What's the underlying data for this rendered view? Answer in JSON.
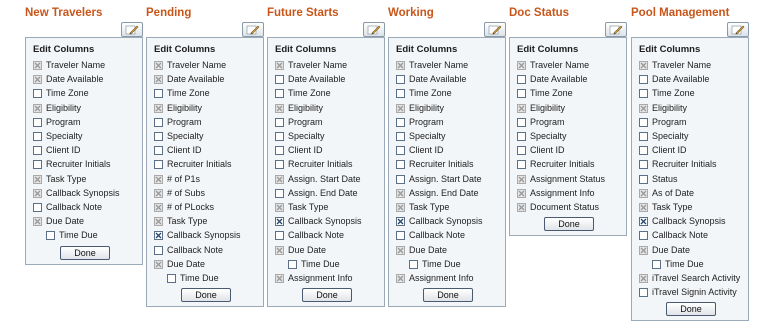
{
  "edit_columns_title": "Edit Columns",
  "done_label": "Done",
  "colors": {
    "title": "#c8561a",
    "checkbox_border": "#5b6f86",
    "checkbox_disabled": "#aaaaaa",
    "panel_bg": "#f3f6f8"
  },
  "panels": [
    {
      "title": "New Travelers",
      "items": [
        {
          "label": "Traveler Name",
          "state": "grey"
        },
        {
          "label": "Date Available",
          "state": "grey"
        },
        {
          "label": "Time Zone",
          "state": "empty"
        },
        {
          "label": "Eligibility",
          "state": "grey"
        },
        {
          "label": "Program",
          "state": "empty"
        },
        {
          "label": "Specialty",
          "state": "empty"
        },
        {
          "label": "Client ID",
          "state": "empty"
        },
        {
          "label": "Recruiter Initials",
          "state": "empty"
        },
        {
          "label": "Task Type",
          "state": "grey"
        },
        {
          "label": "Callback Synopsis",
          "state": "grey"
        },
        {
          "label": "Callback Note",
          "state": "empty"
        },
        {
          "label": "Due Date",
          "state": "grey"
        },
        {
          "label": "Time Due",
          "state": "empty",
          "indent": true
        }
      ]
    },
    {
      "title": "Pending",
      "items": [
        {
          "label": "Traveler Name",
          "state": "grey"
        },
        {
          "label": "Date Available",
          "state": "grey"
        },
        {
          "label": "Time Zone",
          "state": "empty"
        },
        {
          "label": "Eligibility",
          "state": "grey"
        },
        {
          "label": "Program",
          "state": "empty"
        },
        {
          "label": "Specialty",
          "state": "empty"
        },
        {
          "label": "Client ID",
          "state": "empty"
        },
        {
          "label": "Recruiter Initials",
          "state": "empty"
        },
        {
          "label": "# of P1s",
          "state": "grey"
        },
        {
          "label": "# of Subs",
          "state": "grey"
        },
        {
          "label": "# of PLocks",
          "state": "grey"
        },
        {
          "label": "Task Type",
          "state": "grey"
        },
        {
          "label": "Callback Synopsis",
          "state": "checked"
        },
        {
          "label": "Callback Note",
          "state": "empty"
        },
        {
          "label": "Due Date",
          "state": "grey"
        },
        {
          "label": "Time Due",
          "state": "empty",
          "indent": true
        }
      ]
    },
    {
      "title": "Future Starts",
      "items": [
        {
          "label": "Traveler Name",
          "state": "grey"
        },
        {
          "label": "Date Available",
          "state": "empty"
        },
        {
          "label": "Time Zone",
          "state": "empty"
        },
        {
          "label": "Eligibility",
          "state": "grey"
        },
        {
          "label": "Program",
          "state": "empty"
        },
        {
          "label": "Specialty",
          "state": "empty"
        },
        {
          "label": "Client ID",
          "state": "empty"
        },
        {
          "label": "Recruiter Initials",
          "state": "empty"
        },
        {
          "label": "Assign. Start Date",
          "state": "grey"
        },
        {
          "label": "Assign. End Date",
          "state": "empty"
        },
        {
          "label": "Task Type",
          "state": "grey"
        },
        {
          "label": "Callback Synopsis",
          "state": "checked"
        },
        {
          "label": "Callback Note",
          "state": "empty"
        },
        {
          "label": "Due Date",
          "state": "grey"
        },
        {
          "label": "Time Due",
          "state": "empty",
          "indent": true
        },
        {
          "label": "Assignment Info",
          "state": "grey"
        }
      ]
    },
    {
      "title": "Working",
      "items": [
        {
          "label": "Traveler Name",
          "state": "grey"
        },
        {
          "label": "Date Available",
          "state": "empty"
        },
        {
          "label": "Time Zone",
          "state": "empty"
        },
        {
          "label": "Eligibility",
          "state": "grey"
        },
        {
          "label": "Program",
          "state": "empty"
        },
        {
          "label": "Specialty",
          "state": "empty"
        },
        {
          "label": "Client ID",
          "state": "empty"
        },
        {
          "label": "Recruiter Initials",
          "state": "empty"
        },
        {
          "label": "Assign. Start Date",
          "state": "empty"
        },
        {
          "label": "Assign. End Date",
          "state": "grey"
        },
        {
          "label": "Task Type",
          "state": "grey"
        },
        {
          "label": "Callback Synopsis",
          "state": "checked"
        },
        {
          "label": "Callback Note",
          "state": "empty"
        },
        {
          "label": "Due Date",
          "state": "grey"
        },
        {
          "label": "Time Due",
          "state": "empty",
          "indent": true
        },
        {
          "label": "Assignment Info",
          "state": "grey"
        }
      ]
    },
    {
      "title": "Doc Status",
      "items": [
        {
          "label": "Traveler Name",
          "state": "grey"
        },
        {
          "label": "Date Available",
          "state": "empty"
        },
        {
          "label": "Time Zone",
          "state": "empty"
        },
        {
          "label": "Eligibility",
          "state": "grey"
        },
        {
          "label": "Program",
          "state": "empty"
        },
        {
          "label": "Specialty",
          "state": "empty"
        },
        {
          "label": "Client ID",
          "state": "empty"
        },
        {
          "label": "Recruiter Initials",
          "state": "empty"
        },
        {
          "label": "Assignment Status",
          "state": "grey"
        },
        {
          "label": "Assignment Info",
          "state": "grey"
        },
        {
          "label": "Document Status",
          "state": "grey"
        }
      ]
    },
    {
      "title": "Pool Management",
      "items": [
        {
          "label": "Traveler Name",
          "state": "grey"
        },
        {
          "label": "Date Available",
          "state": "empty"
        },
        {
          "label": "Time Zone",
          "state": "empty"
        },
        {
          "label": "Eligibility",
          "state": "grey"
        },
        {
          "label": "Program",
          "state": "empty"
        },
        {
          "label": "Specialty",
          "state": "empty"
        },
        {
          "label": "Client ID",
          "state": "empty"
        },
        {
          "label": "Recruiter Initials",
          "state": "empty"
        },
        {
          "label": "Status",
          "state": "empty"
        },
        {
          "label": "As of Date",
          "state": "grey"
        },
        {
          "label": "Task Type",
          "state": "grey"
        },
        {
          "label": "Callback Synopsis",
          "state": "checked"
        },
        {
          "label": "Callback Note",
          "state": "empty"
        },
        {
          "label": "Due Date",
          "state": "grey"
        },
        {
          "label": "Time Due",
          "state": "empty",
          "indent": true
        },
        {
          "label": "iTravel Search Activity",
          "state": "grey"
        },
        {
          "label": "iTravel Signin Activity",
          "state": "empty"
        }
      ]
    }
  ]
}
